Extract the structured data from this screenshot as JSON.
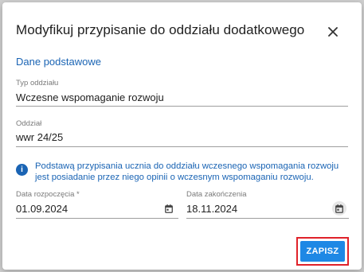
{
  "dialog": {
    "title": "Modyfikuj przypisanie do oddziału dodatkowego",
    "close_icon": "close-icon"
  },
  "section_title": "Dane podstawowe",
  "fields": {
    "unit_type": {
      "label": "Typ oddziału",
      "value": "Wczesne wspomaganie rozwoju"
    },
    "unit": {
      "label": "Oddział",
      "value": "wwr 24/25"
    },
    "start_date": {
      "label": "Data rozpoczęcia *",
      "value": "01.09.2024",
      "icon": "calendar-icon"
    },
    "end_date": {
      "label": "Data zakończenia",
      "value": "18.11.2024",
      "icon": "calendar-icon"
    }
  },
  "info": {
    "icon": "info-icon",
    "text": "Podstawą przypisania ucznia do oddziału wczesnego wspomagania rozwoju jest posiadanie przez niego opinii o wczesnym wspomaganiu rozwoju."
  },
  "actions": {
    "save_label": "ZAPISZ"
  },
  "colors": {
    "accent": "#1a64b4",
    "button": "#1e88e5",
    "highlight": "#e0222a"
  }
}
